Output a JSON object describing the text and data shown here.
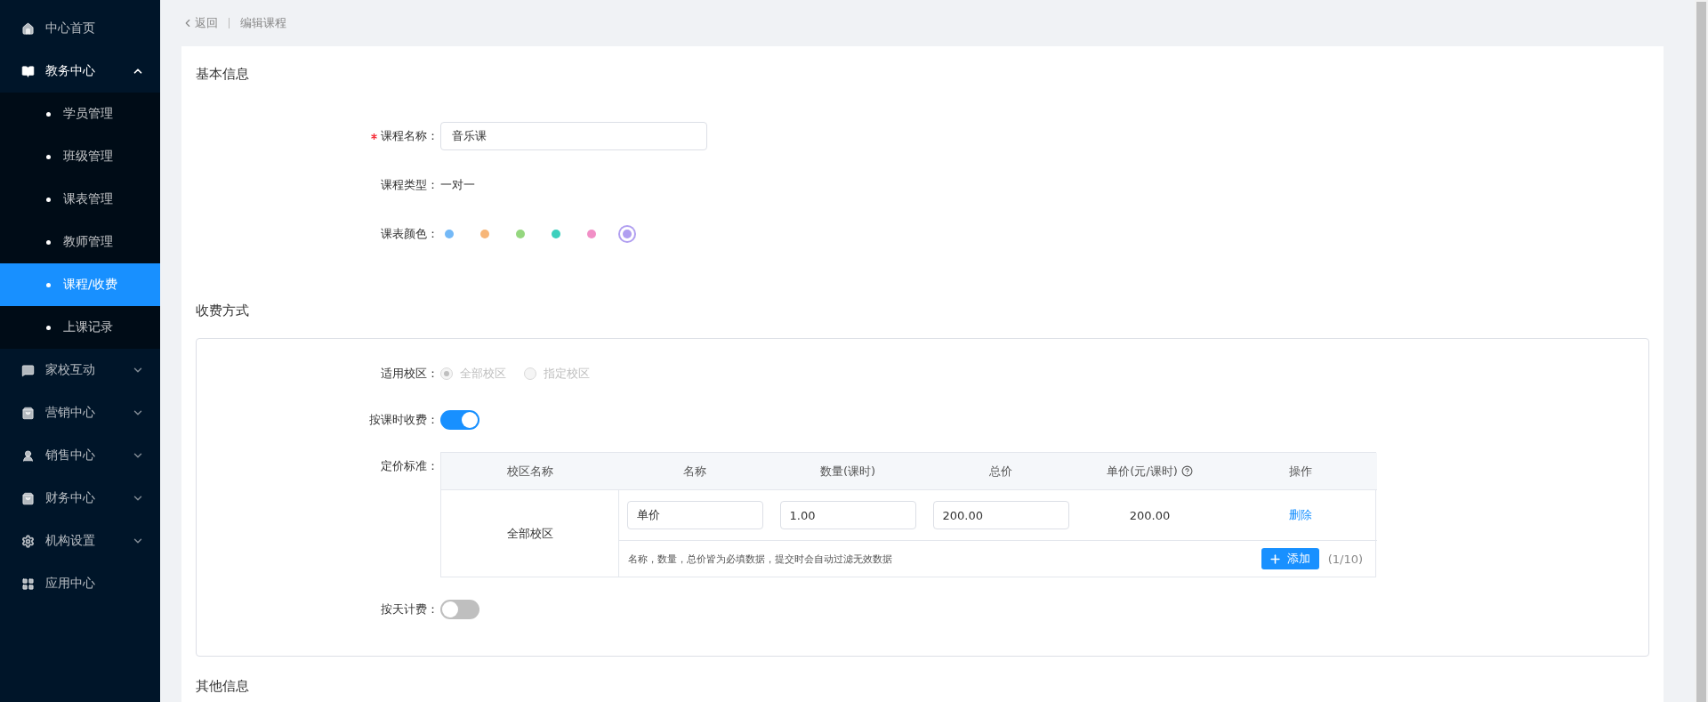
{
  "sidebar": {
    "items": [
      {
        "label": "中心首页",
        "expandable": false,
        "expanded": false
      },
      {
        "label": "教务中心",
        "expandable": true,
        "expanded": true,
        "children": [
          {
            "label": "学员管理",
            "selected": false
          },
          {
            "label": "班级管理",
            "selected": false
          },
          {
            "label": "课表管理",
            "selected": false
          },
          {
            "label": "教师管理",
            "selected": false
          },
          {
            "label": "课程/收费",
            "selected": true
          },
          {
            "label": "上课记录",
            "selected": false
          }
        ]
      },
      {
        "label": "家校互动",
        "expandable": true,
        "expanded": false
      },
      {
        "label": "营销中心",
        "expandable": true,
        "expanded": false
      },
      {
        "label": "销售中心",
        "expandable": true,
        "expanded": false
      },
      {
        "label": "财务中心",
        "expandable": true,
        "expanded": false
      },
      {
        "label": "机构设置",
        "expandable": true,
        "expanded": false
      },
      {
        "label": "应用中心",
        "expandable": false,
        "expanded": false
      }
    ]
  },
  "breadcrumb": {
    "back": "返回",
    "current": "编辑课程"
  },
  "sections": [
    {
      "title": "基本信息",
      "boxed": false,
      "fields": [
        {
          "kind": "input",
          "label": "课程名称：",
          "required": true,
          "value": "音乐课"
        },
        {
          "kind": "text",
          "label": "课程类型：",
          "required": false,
          "value": "一对一"
        },
        {
          "kind": "colors",
          "label": "课表颜色：",
          "required": false,
          "options": [
            {
              "color": "#74b9f7",
              "selected": false
            },
            {
              "color": "#f7b678",
              "selected": false
            },
            {
              "color": "#95d77f",
              "selected": false
            },
            {
              "color": "#3dd0bd",
              "selected": false
            },
            {
              "color": "#f18fc6",
              "selected": false
            },
            {
              "color": "#b09ef0",
              "selected": true
            }
          ]
        }
      ]
    },
    {
      "title": "收费方式",
      "boxed": true,
      "fields": [
        {
          "kind": "radio",
          "label": "适用校区：",
          "required": false,
          "disabled": true,
          "options": [
            {
              "label": "全部校区",
              "selected": true
            },
            {
              "label": "指定校区",
              "selected": false
            }
          ]
        },
        {
          "kind": "switch",
          "label": "按课时收费：",
          "required": false,
          "on": true
        },
        {
          "kind": "table",
          "label": "定价标准：",
          "required": false,
          "columns": [
            {
              "label": "校区名称",
              "help": false
            },
            {
              "label": "名称",
              "help": false
            },
            {
              "label": "数量(课时)",
              "help": false
            },
            {
              "label": "总价",
              "help": false
            },
            {
              "label": "单价(元/课时)",
              "help": true
            },
            {
              "label": "操作",
              "help": false
            }
          ],
          "groups": [
            {
              "campus": "全部校区",
              "rows": [
                {
                  "name": "单价",
                  "quantity": "1.00",
                  "total": "200.00",
                  "unit_price": "200.00",
                  "action": "删除"
                }
              ],
              "note": "名称，数量，总价皆为必填数据，提交时会自动过滤无效数据",
              "add_button": "添加",
              "count": "(1/10)"
            }
          ]
        },
        {
          "kind": "switch",
          "label": "按天计费：",
          "required": false,
          "on": false
        }
      ]
    },
    {
      "title": "其他信息",
      "boxed": false
    }
  ]
}
